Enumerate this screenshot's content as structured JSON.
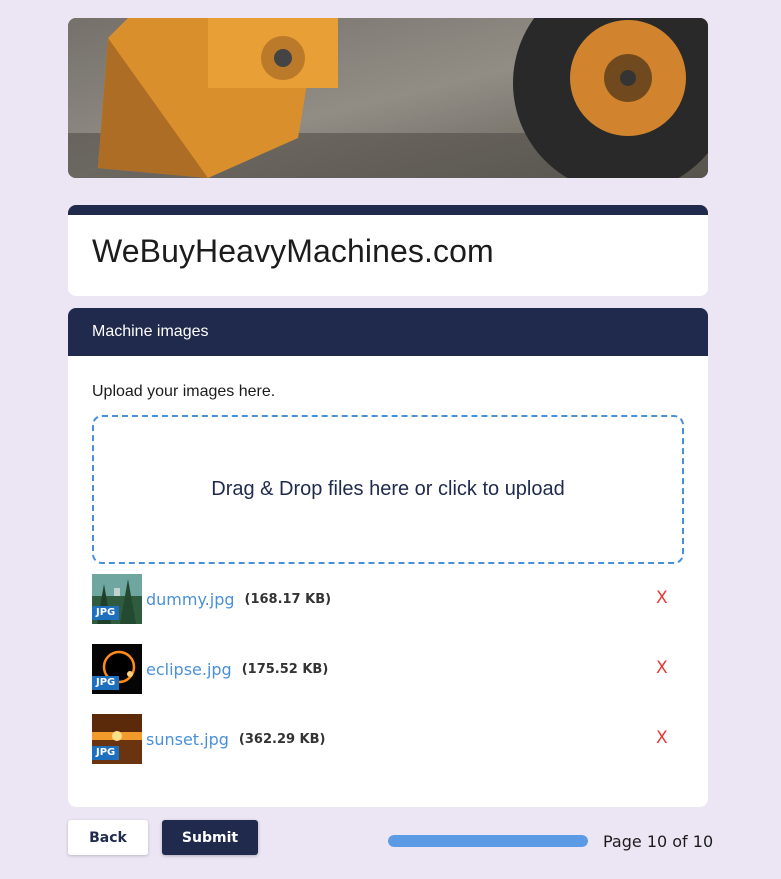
{
  "hero": {
    "image": "construction-loader-photo"
  },
  "header": {
    "title": "WeBuyHeavyMachines.com"
  },
  "section": {
    "title": "Machine images",
    "upload_label": "Upload your images here.",
    "dropzone_text": "Drag & Drop files here or click to upload",
    "files": [
      {
        "name": "dummy.jpg",
        "size": "(168.17 KB)",
        "badge": "JPG",
        "remove": "X"
      },
      {
        "name": "eclipse.jpg",
        "size": "(175.52 KB)",
        "badge": "JPG",
        "remove": "X"
      },
      {
        "name": "sunset.jpg",
        "size": "(362.29 KB)",
        "badge": "JPG",
        "remove": "X"
      }
    ]
  },
  "footer": {
    "back_label": "Back",
    "submit_label": "Submit",
    "progress_fraction": 1.0,
    "page_text": "Page 10 of 10"
  },
  "colors": {
    "navy": "#1f2a4d",
    "background": "#ebe5f4",
    "link_blue": "#4a90d9",
    "remove_red": "#e53935",
    "progress_fill": "#5b9be6"
  }
}
